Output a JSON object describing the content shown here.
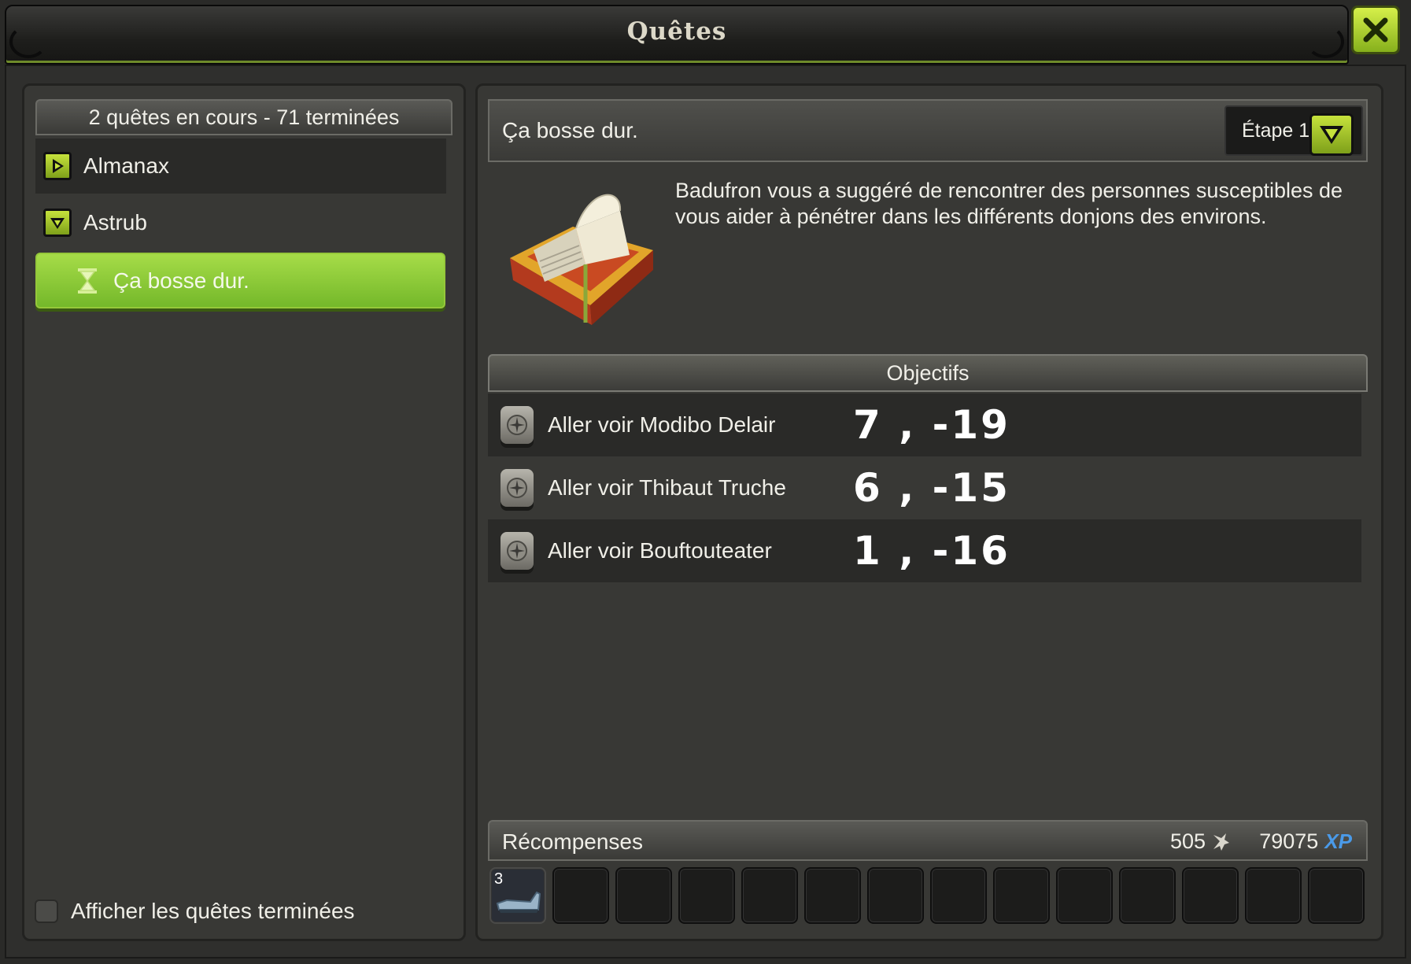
{
  "window": {
    "title": "Quêtes"
  },
  "left": {
    "summary": "2 quêtes en cours - 71 terminées",
    "categories": [
      {
        "label": "Almanax",
        "state": "collapsed"
      },
      {
        "label": "Astrub",
        "state": "expanded"
      }
    ],
    "selected_quest": "Ça bosse dur.",
    "show_finished_label": "Afficher les quêtes terminées"
  },
  "quest": {
    "name": "Ça bosse dur.",
    "step_label": "Étape 1",
    "description": "Badufron vous a suggéré de rencontrer des personnes susceptibles de vous aider à pénétrer dans les différents donjons des environs.",
    "objectives_title": "Objectifs",
    "objectives": [
      {
        "label": "Aller voir Modibo Delair",
        "x": "7",
        "y": "-19"
      },
      {
        "label": "Aller voir Thibaut Truche",
        "x": "6",
        "y": "-15"
      },
      {
        "label": "Aller voir Bouftouteater",
        "x": "1",
        "y": "-16"
      }
    ]
  },
  "rewards": {
    "title": "Récompenses",
    "kamas": "505",
    "xp": "79075",
    "xp_tag": "XP",
    "first_item_qty": "3"
  },
  "colors": {
    "accent_green": "#8cc63a",
    "xp_blue": "#4a9ae8"
  }
}
